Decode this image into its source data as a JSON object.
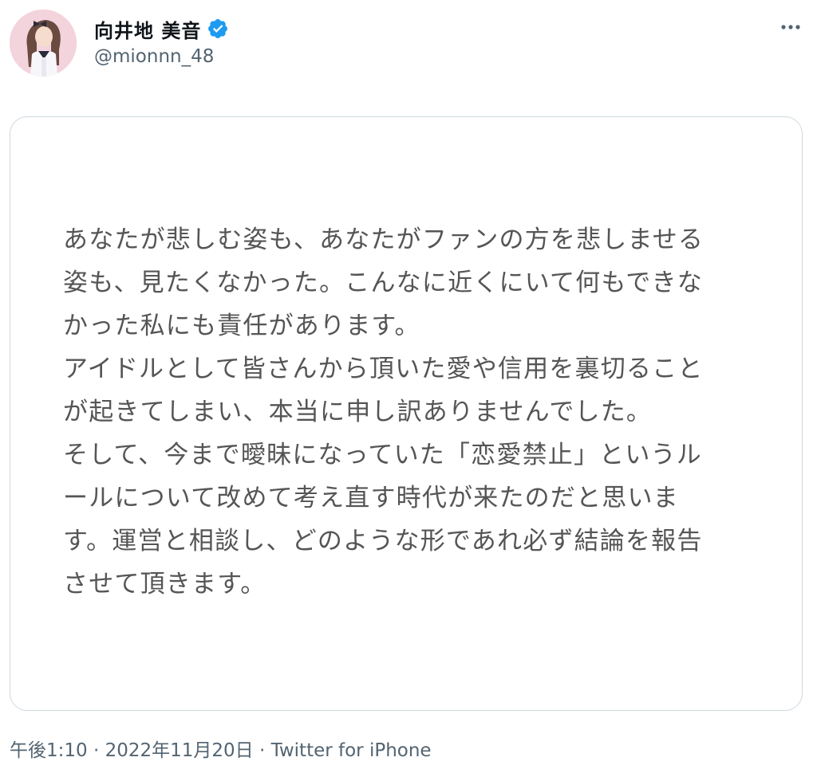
{
  "tweet": {
    "author": {
      "display_name": "向井地 美音",
      "handle": "@mionnn_48",
      "verified": true,
      "avatar_icon": "profile-photo",
      "verified_icon": "verified-badge-icon"
    },
    "more_icon": "more-horizontal-icon",
    "image_text_lines": [
      "あなたが悲しむ姿も、あなたがファンの方を悲しませる",
      "姿も、見たくなかった。こんなに近くにいて何もできな",
      "かった私にも責任があります。",
      "アイドルとして皆さんから頂いた愛や信用を裏切ること",
      "が起きてしまい、本当に申し訳ありませんでした。",
      "そして、今まで曖昧になっていた「恋愛禁止」というル",
      "ールについて改めて考え直す時代が来たのだと思いま",
      "す。運営と相談し、どのような形であれ必ず結論を報告",
      "させて頂きます。"
    ],
    "time": "午後1:10",
    "separator": " · ",
    "date": "2022年11月20日",
    "source": "Twitter for iPhone"
  },
  "colors": {
    "verified_blue": "#1d9bf0",
    "secondary_text": "#536471",
    "card_border": "#cfd9de",
    "card_text": "#555555"
  }
}
